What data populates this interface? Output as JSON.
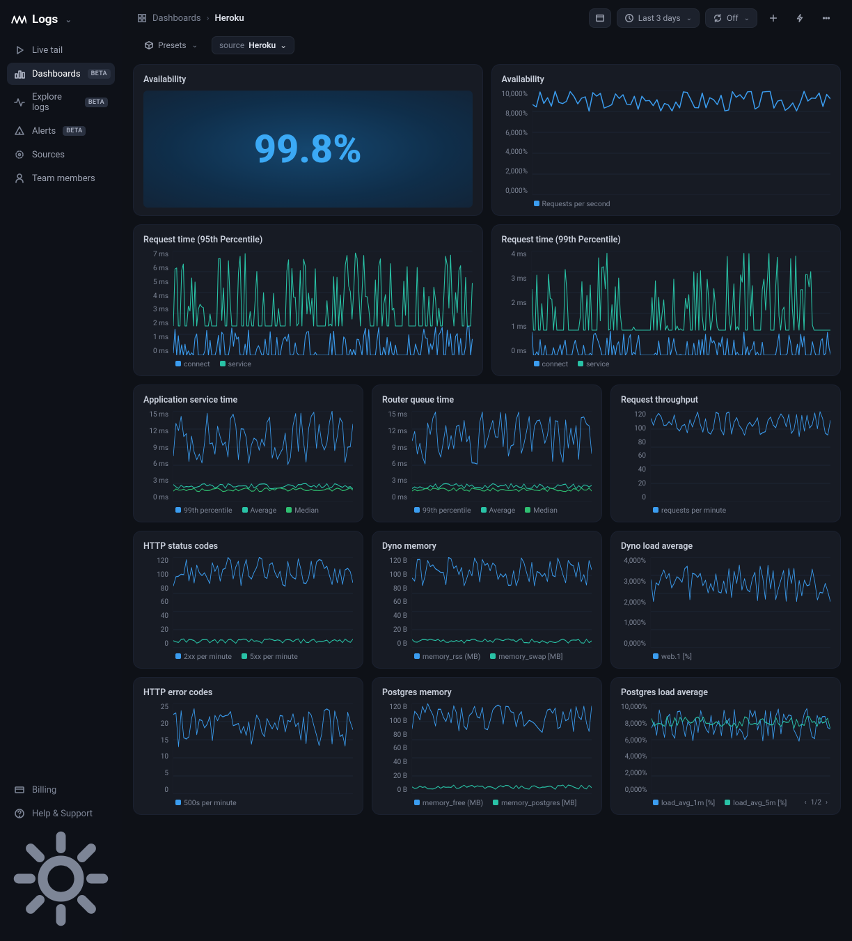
{
  "brand": "Logs",
  "sidebar": {
    "items": [
      {
        "label": "Live tail"
      },
      {
        "label": "Dashboards",
        "badge": "BETA"
      },
      {
        "label": "Explore logs",
        "badge": "BETA"
      },
      {
        "label": "Alerts",
        "badge": "BETA"
      },
      {
        "label": "Sources"
      },
      {
        "label": "Team members"
      }
    ],
    "bottom": [
      {
        "label": "Billing"
      },
      {
        "label": "Help & Support"
      }
    ]
  },
  "breadcrumb": {
    "root": "Dashboards",
    "current": "Heroku"
  },
  "toolbar": {
    "presets": "Presets",
    "filter_key": "source",
    "filter_val": "Heroku",
    "range": "Last 3 days",
    "refresh": "Off"
  },
  "colors": {
    "blue": "#3b9df0",
    "teal": "#29c2a6",
    "green": "#2fbf71"
  },
  "cards": {
    "avail_big": {
      "title": "Availability",
      "value": "99.8%"
    },
    "avail_chart": {
      "title": "Availability",
      "yticks": [
        "10,000%",
        "8,000%",
        "6,000%",
        "4,000%",
        "2,000%",
        "0,000%"
      ],
      "legend": [
        "Requests per second"
      ]
    },
    "rq95": {
      "title": "Request time (95th Percentile)",
      "yticks": [
        "7 ms",
        "6 ms",
        "5 ms",
        "4 ms",
        "3 ms",
        "2 ms",
        "1 ms",
        "0 ms"
      ],
      "legend": [
        "connect",
        "service"
      ]
    },
    "rq99": {
      "title": "Request time (99th Percentile)",
      "yticks": [
        "4 ms",
        "3 ms",
        "2 ms",
        "1 ms",
        "0 ms"
      ],
      "legend": [
        "connect",
        "service"
      ]
    },
    "svc_time": {
      "title": "Application service time",
      "yticks": [
        "15 ms",
        "12 ms",
        "9 ms",
        "6 ms",
        "3 ms",
        "0 ms"
      ],
      "legend": [
        "99th percentile",
        "Average",
        "Median"
      ]
    },
    "router_q": {
      "title": "Router queue time",
      "yticks": [
        "15 ms",
        "12 ms",
        "9 ms",
        "6 ms",
        "3 ms",
        "0 ms"
      ],
      "legend": [
        "99th percentile",
        "Average",
        "Median"
      ]
    },
    "throughput": {
      "title": "Request throughput",
      "yticks": [
        "120",
        "100",
        "80",
        "60",
        "40",
        "20",
        "0"
      ],
      "legend": [
        "requests per minute"
      ]
    },
    "http_status": {
      "title": "HTTP status codes",
      "yticks": [
        "120",
        "100",
        "80",
        "60",
        "40",
        "20",
        "0"
      ],
      "legend": [
        "2xx per minute",
        "5xx per minute"
      ]
    },
    "dyno_mem": {
      "title": "Dyno memory",
      "yticks": [
        "120 B",
        "100 B",
        "80 B",
        "60 B",
        "40 B",
        "20 B",
        "0 B"
      ],
      "legend": [
        "memory_rss (MB)",
        "memory_swap [MB]"
      ]
    },
    "dyno_load": {
      "title": "Dyno load average",
      "yticks": [
        "4,000%",
        "3,000%",
        "2,000%",
        "1,000%",
        "0,000%"
      ],
      "legend": [
        "web.1 [%]"
      ]
    },
    "http_err": {
      "title": "HTTP error codes",
      "yticks": [
        "25",
        "20",
        "15",
        "10",
        "5",
        "0"
      ],
      "legend": [
        "500s per minute"
      ]
    },
    "pg_mem": {
      "title": "Postgres memory",
      "yticks": [
        "120 B",
        "100 B",
        "80 B",
        "60 B",
        "40 B",
        "20 B",
        "0 B"
      ],
      "legend": [
        "memory_free (MB)",
        "memory_postgres [MB]"
      ]
    },
    "pg_load": {
      "title": "Postgres load average",
      "yticks": [
        "10,000%",
        "8,000%",
        "6,000%",
        "4,000%",
        "2,000%",
        "0,000%"
      ],
      "legend": [
        "load_avg_1m [%]",
        "load_avg_5m [%]"
      ],
      "page": "1/2"
    }
  },
  "chart_data": [
    {
      "id": "avail_chart",
      "type": "line",
      "ylim": [
        0,
        10000
      ],
      "series": [
        {
          "name": "Requests per second",
          "color": "#3b9df0",
          "approx": "oscillates between 8000 and 10000 across full range"
        }
      ]
    },
    {
      "id": "rq95",
      "type": "line",
      "ylim": [
        0,
        7
      ],
      "series": [
        {
          "name": "connect",
          "color": "#3b9df0",
          "approx": "dense spikes 0-2 ms"
        },
        {
          "name": "service",
          "color": "#29c2a6",
          "approx": "dense spikes 2-7 ms"
        }
      ]
    },
    {
      "id": "rq99",
      "type": "line",
      "ylim": [
        0,
        4
      ],
      "series": [
        {
          "name": "connect",
          "color": "#3b9df0",
          "approx": "dense spikes 0-1 ms"
        },
        {
          "name": "service",
          "color": "#29c2a6",
          "approx": "dense spikes 1-4 ms"
        }
      ]
    },
    {
      "id": "svc_time",
      "type": "line",
      "ylim": [
        0,
        15
      ],
      "series": [
        {
          "name": "99th percentile",
          "color": "#3b9df0",
          "approx": "noisy 6-15 ms"
        },
        {
          "name": "Average",
          "color": "#29c2a6",
          "approx": "flat ~2.5 ms"
        },
        {
          "name": "Median",
          "color": "#2fbf71",
          "approx": "flat ~2 ms"
        }
      ]
    },
    {
      "id": "router_q",
      "type": "line",
      "ylim": [
        0,
        15
      ],
      "series": [
        {
          "name": "99th percentile",
          "color": "#3b9df0",
          "approx": "noisy 6-15 ms"
        },
        {
          "name": "Average",
          "color": "#29c2a6",
          "approx": "flat ~2.5 ms"
        },
        {
          "name": "Median",
          "color": "#2fbf71",
          "approx": "flat ~2 ms"
        }
      ]
    },
    {
      "id": "throughput",
      "type": "line",
      "ylim": [
        0,
        120
      ],
      "series": [
        {
          "name": "requests per minute",
          "color": "#3b9df0",
          "approx": "noisy 85-120"
        }
      ]
    },
    {
      "id": "http_status",
      "type": "line",
      "ylim": [
        0,
        120
      ],
      "series": [
        {
          "name": "2xx per minute",
          "color": "#3b9df0",
          "approx": "noisy 85-120"
        },
        {
          "name": "5xx per minute",
          "color": "#29c2a6",
          "approx": "flat ~8"
        }
      ]
    },
    {
      "id": "dyno_mem",
      "type": "line",
      "ylim": [
        0,
        120
      ],
      "series": [
        {
          "name": "memory_rss (MB)",
          "color": "#3b9df0",
          "approx": "noisy 80-120"
        },
        {
          "name": "memory_swap [MB]",
          "color": "#29c2a6",
          "approx": "flat ~8"
        }
      ]
    },
    {
      "id": "dyno_load",
      "type": "line",
      "ylim": [
        0,
        4000
      ],
      "series": [
        {
          "name": "web.1 [%]",
          "color": "#3b9df0",
          "approx": "noisy 2000-4000"
        }
      ]
    },
    {
      "id": "http_err",
      "type": "line",
      "ylim": [
        0,
        25
      ],
      "series": [
        {
          "name": "500s per minute",
          "color": "#3b9df0",
          "approx": "noisy 14-22"
        }
      ]
    },
    {
      "id": "pg_mem",
      "type": "line",
      "ylim": [
        0,
        120
      ],
      "series": [
        {
          "name": "memory_free (MB)",
          "color": "#3b9df0",
          "approx": "noisy 85-120"
        },
        {
          "name": "memory_postgres [MB]",
          "color": "#29c2a6",
          "approx": "flat ~10"
        }
      ]
    },
    {
      "id": "pg_load",
      "type": "line",
      "ylim": [
        0,
        10000
      ],
      "series": [
        {
          "name": "load_avg_1m [%]",
          "color": "#3b9df0",
          "approx": "noisy 6000-9500"
        },
        {
          "name": "load_avg_5m [%]",
          "color": "#29c2a6",
          "approx": "smoother 7500-8500"
        }
      ]
    }
  ]
}
